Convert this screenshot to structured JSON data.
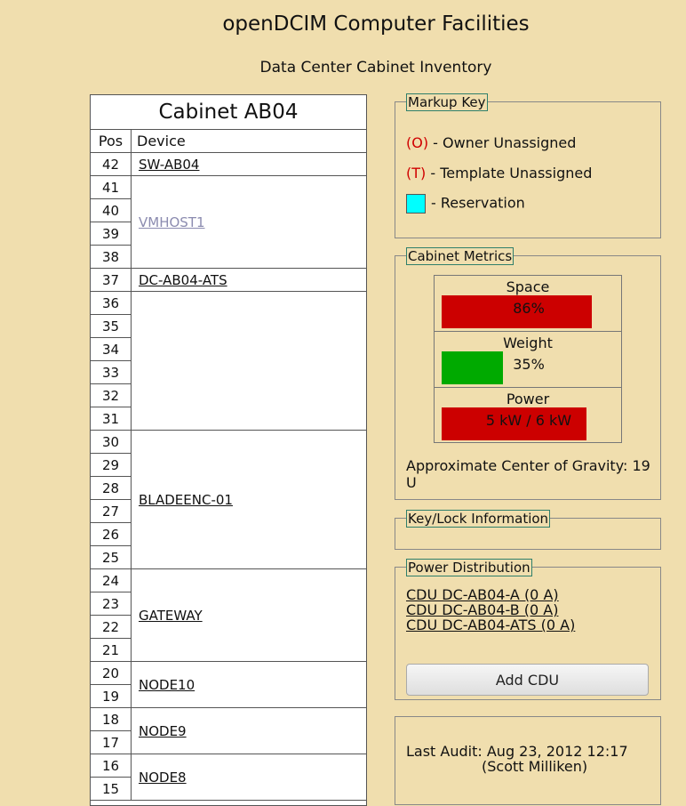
{
  "page": {
    "title": "openDCIM Computer Facilities",
    "subtitle": "Data Center Cabinet Inventory"
  },
  "cabinet": {
    "title": "Cabinet AB04",
    "col_pos": "Pos",
    "col_device": "Device",
    "positions": [
      "42",
      "41",
      "40",
      "39",
      "38",
      "37",
      "36",
      "35",
      "34",
      "33",
      "32",
      "31",
      "30",
      "29",
      "28",
      "27",
      "26",
      "25",
      "24",
      "23",
      "22",
      "21",
      "20",
      "19",
      "18",
      "17",
      "16",
      "15"
    ],
    "devices": [
      {
        "name": "SW-AB04",
        "top_u": 42,
        "height_u": 1
      },
      {
        "name": "VMHOST1",
        "top_u": 41,
        "height_u": 4,
        "muted": true
      },
      {
        "name": "DC-AB04-ATS",
        "top_u": 37,
        "height_u": 1
      },
      {
        "name": "",
        "top_u": 36,
        "height_u": 6
      },
      {
        "name": "BLADEENC-01",
        "top_u": 30,
        "height_u": 6
      },
      {
        "name": "GATEWAY",
        "top_u": 24,
        "height_u": 4
      },
      {
        "name": "NODE10",
        "top_u": 20,
        "height_u": 2
      },
      {
        "name": "NODE9",
        "top_u": 18,
        "height_u": 2
      },
      {
        "name": "NODE8",
        "top_u": 16,
        "height_u": 2
      }
    ]
  },
  "markup_key": {
    "legend": "Markup Key",
    "owner_tag": "(O)",
    "owner_text": " - Owner Unassigned",
    "template_tag": "(T)",
    "template_text": " - Template Unassigned",
    "reservation_text": "- Reservation",
    "reservation_color": "#00ffff"
  },
  "metrics": {
    "legend": "Cabinet Metrics",
    "space": {
      "label": "Space",
      "text": "86%",
      "fraction": 0.86,
      "color": "#cc0000"
    },
    "weight": {
      "label": "Weight",
      "text": "35%",
      "fraction": 0.35,
      "color": "#00aa00"
    },
    "power": {
      "label": "Power",
      "text": "5 kW / 6 kW",
      "fraction": 0.8333,
      "color": "#cc0000"
    },
    "cog": "Approximate Center of Gravity: 19 U"
  },
  "keylock": {
    "legend": "Key/Lock Information"
  },
  "power_distribution": {
    "legend": "Power Distribution",
    "cdus": [
      "CDU DC-AB04-A (0 A)",
      "CDU DC-AB04-B (0 A)",
      "CDU DC-AB04-ATS (0 A)"
    ],
    "add_button": "Add CDU"
  },
  "audit": {
    "line1": "Last Audit: Aug 23, 2012 12:17",
    "line2": "(Scott Milliken)"
  }
}
